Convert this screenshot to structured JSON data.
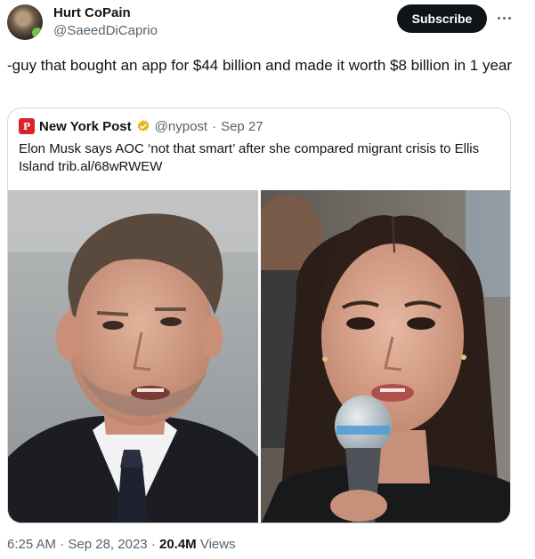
{
  "author": {
    "name": "Hurt CoPain",
    "handle": "@SaeedDiCaprio"
  },
  "subscribe_label": "Subscribe",
  "tweet_text": "-guy that bought an app for $44 billion and made it worth $8 billion in 1 year",
  "quote": {
    "logo_text": "P",
    "name": "New York Post",
    "handle": "@nypost",
    "separator": "·",
    "date": "Sep 27",
    "text": "Elon Musk says AOC ‘not that smart’ after she compared migrant crisis to Ellis Island trib.al/68wRWEW"
  },
  "meta": {
    "time": "6:25 AM",
    "dot1": "·",
    "date": "Sep 28, 2023",
    "dot2": "·",
    "views_count": "20.4M",
    "views_label": "Views"
  },
  "icons": {
    "verified": "gold-check-badge",
    "more": "three-dots"
  },
  "colors": {
    "subscribe_bg": "#0f1419",
    "secondary_text": "#536471",
    "border": "#cfd9de",
    "nypost_red": "#d9232a",
    "verified_gold": "#e2b719"
  }
}
